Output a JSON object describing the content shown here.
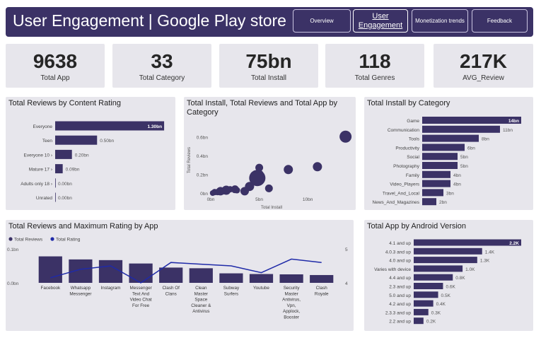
{
  "header": {
    "title": "User Engagement | Google Play store",
    "nav": [
      {
        "label": "Overview",
        "active": false
      },
      {
        "label": "User Engagement",
        "active": true
      },
      {
        "label": "Monetization trends",
        "active": false
      },
      {
        "label": "Feedback",
        "active": false
      }
    ]
  },
  "kpis": [
    {
      "value": "9638",
      "label": "Total App"
    },
    {
      "value": "33",
      "label": "Total Category"
    },
    {
      "value": "75bn",
      "label": "Total Install"
    },
    {
      "value": "118",
      "label": "Total Genres"
    },
    {
      "value": "217K",
      "label": "AVG_Review"
    }
  ],
  "colors": {
    "bar": "#3b3266",
    "line": "#1f2aa8",
    "panel": "#e7e6ec",
    "header": "#3b3266"
  },
  "chart_data": [
    {
      "id": "reviews_by_content_rating",
      "type": "bar",
      "orientation": "horizontal",
      "title": "Total Reviews by Content Rating",
      "categories": [
        "Everyone",
        "Teen",
        "Everyone 10+",
        "Mature 17+",
        "Adults only 18+",
        "Unrated"
      ],
      "category_labels": [
        "Everyone",
        "Teen",
        "Everyone 10 ›",
        "Mature 17 ›",
        "Adults only 18 ›",
        "Unrated"
      ],
      "values": [
        1.3,
        0.5,
        0.2,
        0.09,
        0.0,
        0.0
      ],
      "data_labels": [
        "1.30bn",
        "0.50bn",
        "0.20bn",
        "0.09bn",
        "0.00bn",
        "0.00bn"
      ],
      "xlim": [
        0,
        1.35
      ]
    },
    {
      "id": "install_reviews_apps_by_category",
      "type": "scatter",
      "title": "Total Install, Total Reviews and Total App by Category",
      "xlabel": "Total Install",
      "ylabel": "Total Reviews",
      "xlim": [
        0,
        14
      ],
      "ylim": [
        0,
        0.7
      ],
      "x_ticks": [
        {
          "v": 0,
          "label": "0bn"
        },
        {
          "v": 5,
          "label": "5bn"
        },
        {
          "v": 10,
          "label": "10bn"
        }
      ],
      "y_ticks": [
        {
          "v": 0,
          "label": "0bn"
        },
        {
          "v": 0.2,
          "label": "0.2bn"
        },
        {
          "v": 0.4,
          "label": "0.4bn"
        },
        {
          "v": 0.6,
          "label": "0.6bn"
        }
      ],
      "points": [
        {
          "x": 13.9,
          "y": 0.6,
          "size": 14
        },
        {
          "x": 11.0,
          "y": 0.28,
          "size": 10
        },
        {
          "x": 8.0,
          "y": 0.25,
          "size": 10
        },
        {
          "x": 6.0,
          "y": 0.05,
          "size": 8
        },
        {
          "x": 5.0,
          "y": 0.2,
          "size": 9
        },
        {
          "x": 5.0,
          "y": 0.27,
          "size": 8
        },
        {
          "x": 4.8,
          "y": 0.16,
          "size": 20
        },
        {
          "x": 4.0,
          "y": 0.07,
          "size": 10
        },
        {
          "x": 3.5,
          "y": 0.02,
          "size": 9
        },
        {
          "x": 2.7,
          "y": 0.03,
          "size": 6
        },
        {
          "x": 2.5,
          "y": 0.04,
          "size": 8
        },
        {
          "x": 2.0,
          "y": 0.04,
          "size": 6
        },
        {
          "x": 1.6,
          "y": 0.03,
          "size": 10
        },
        {
          "x": 1.2,
          "y": 0.02,
          "size": 7
        },
        {
          "x": 1.0,
          "y": 0.02,
          "size": 9
        },
        {
          "x": 0.7,
          "y": 0.01,
          "size": 6
        },
        {
          "x": 0.4,
          "y": 0.01,
          "size": 6
        },
        {
          "x": 0.2,
          "y": 0.0,
          "size": 5
        }
      ]
    },
    {
      "id": "install_by_category",
      "type": "bar",
      "orientation": "horizontal",
      "title": "Total Install by Category",
      "categories": [
        "Game",
        "Communication",
        "Tools",
        "Productivity",
        "Social",
        "Photography",
        "Family",
        "Video_Players",
        "Travel_And_Local",
        "News_And_Magazines"
      ],
      "values": [
        14,
        11,
        8,
        6,
        5,
        5,
        4,
        4,
        3,
        2
      ],
      "data_labels": [
        "14bn",
        "11bn",
        "8bn",
        "6bn",
        "5bn",
        "5bn",
        "4bn",
        "4bn",
        "3bn",
        "2bn"
      ],
      "xlim": [
        0,
        14
      ]
    },
    {
      "id": "reviews_and_max_rating_by_app",
      "type": "bar",
      "title": "Total Reviews and Maximum Rating by App",
      "legend": [
        {
          "name": "Total Reviews"
        },
        {
          "name": "Total Rating"
        }
      ],
      "categories": [
        "Facebook",
        "Whatsapp Messenger",
        "Instagram",
        "Messenger Text And Video Chat For Free",
        "Clash Of Clans",
        "Clean Master Space Cleaner & Antivirus",
        "Subway Surfers",
        "Youtube",
        "Security Master Antivirus, Vpn, Applock, Booster",
        "Clash Royale"
      ],
      "category_lines": [
        [
          "Facebook"
        ],
        [
          "Whatsapp",
          "Messenger"
        ],
        [
          "Instagram"
        ],
        [
          "Messenger",
          "Text And",
          "Video Chat",
          "For Free"
        ],
        [
          "Clash Of",
          "Clans"
        ],
        [
          "Clean",
          "Master",
          "Space",
          "Cleaner &",
          "Antivirus"
        ],
        [
          "Subway",
          "Surfers"
        ],
        [
          "Youtube"
        ],
        [
          "Security",
          "Master",
          "Antivirus,",
          "Vpn,",
          "Applock,",
          "Booster"
        ],
        [
          "Clash",
          "Royale"
        ]
      ],
      "series": [
        {
          "name": "Total Reviews",
          "axis": "left",
          "kind": "bar",
          "values": [
            0.078,
            0.069,
            0.067,
            0.057,
            0.045,
            0.043,
            0.028,
            0.026,
            0.025,
            0.023
          ]
        },
        {
          "name": "Total Rating",
          "axis": "right",
          "kind": "line",
          "values": [
            4.15,
            4.4,
            4.5,
            4.0,
            4.6,
            4.55,
            4.5,
            4.3,
            4.7,
            4.6
          ]
        }
      ],
      "ylim_left": [
        0,
        0.1
      ],
      "ylim_right": [
        4,
        5
      ],
      "left_ticks": [
        {
          "v": 0,
          "label": "0.0bn"
        },
        {
          "v": 0.1,
          "label": "0.1bn"
        }
      ],
      "right_ticks": [
        {
          "v": 4,
          "label": "4"
        },
        {
          "v": 5,
          "label": "5"
        }
      ]
    },
    {
      "id": "apps_by_android_version",
      "type": "bar",
      "orientation": "horizontal",
      "title": "Total App by Android Version",
      "categories": [
        "4.1 and up",
        "4.0.3 and up",
        "4.0 and up",
        "Varies with device",
        "4.4 and up",
        "2.3 and up",
        "5.0 and up",
        "4.2 and up",
        "2.3.3 and up",
        "2.2 and up"
      ],
      "values": [
        2.2,
        1.4,
        1.3,
        1.0,
        0.8,
        0.6,
        0.5,
        0.4,
        0.3,
        0.2
      ],
      "data_labels": [
        "2.2K",
        "1.4K",
        "1.3K",
        "1.0K",
        "0.8K",
        "0.6K",
        "0.5K",
        "0.4K",
        "0.3K",
        "0.2K"
      ],
      "xlim": [
        0,
        2.2
      ]
    }
  ]
}
